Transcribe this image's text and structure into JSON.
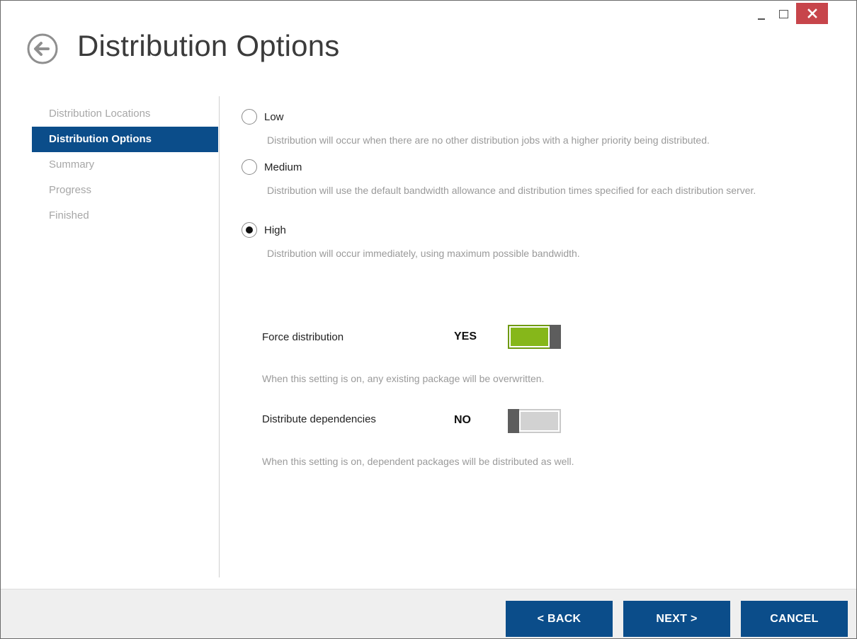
{
  "window": {
    "title": "Distribution Options",
    "close_color": "#c7454b"
  },
  "sidebar": {
    "items": [
      {
        "label": "Distribution Locations",
        "active": false
      },
      {
        "label": "Distribution Options",
        "active": true
      },
      {
        "label": "Summary",
        "active": false
      },
      {
        "label": "Progress",
        "active": false
      },
      {
        "label": "Finished",
        "active": false
      }
    ]
  },
  "priority": {
    "selected": "High",
    "options": [
      {
        "label": "Low",
        "description": "Distribution will occur when there are no other distribution jobs with a higher priority being distributed."
      },
      {
        "label": "Medium",
        "description": "Distribution will use the default bandwidth allowance and distribution times specified for each distribution server."
      },
      {
        "label": "High",
        "description": "Distribution will occur immediately, using maximum possible bandwidth."
      }
    ]
  },
  "options": {
    "force": {
      "label": "Force distribution",
      "state": "YES",
      "hint": "When this setting is on, any existing package will be overwritten."
    },
    "dependencies": {
      "label": "Distribute dependencies",
      "state": "NO",
      "hint": "When this setting is on, dependent packages will be distributed as well."
    }
  },
  "footer": {
    "back": "< BACK",
    "next": "NEXT >",
    "cancel": "CANCEL"
  },
  "colors": {
    "accent": "#0b4d8a",
    "toggle_on": "#86b71a",
    "toggle_off": "#d2d2d2"
  }
}
